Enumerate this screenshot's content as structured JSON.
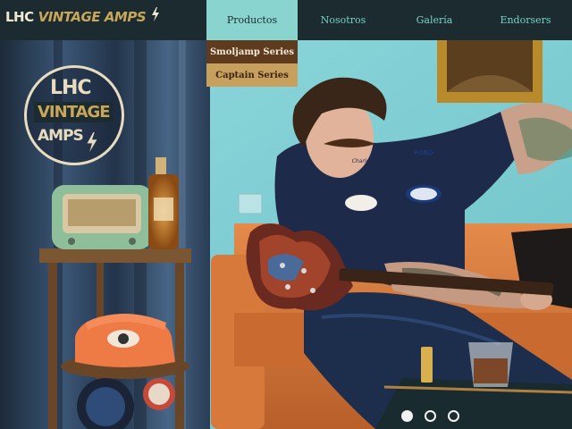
{
  "brand": {
    "part1": "LHC",
    "part2": "VINTAGE AMPS",
    "icon": "lightning-bolt-icon"
  },
  "nav": {
    "items": [
      {
        "label": "Productos",
        "active": true
      },
      {
        "label": "Nosotros",
        "active": false
      },
      {
        "label": "Galería",
        "active": false
      },
      {
        "label": "Endorsers",
        "active": false
      }
    ],
    "dropdown": [
      {
        "label": "Smoljamp Series"
      },
      {
        "label": "Captain Series"
      }
    ]
  },
  "hero": {
    "logo": {
      "line1": "LHC",
      "line2": "VINTAGE",
      "line3": "AMPS"
    },
    "patches": {
      "name": "Charles",
      "badge": "FORD"
    },
    "slider": {
      "count": 3,
      "active_index": 0
    }
  },
  "colors": {
    "topbar": "#1b2b2f",
    "nav_text": "#77d2c6",
    "nav_active_bg": "#8ad4d0",
    "dropdown_dark": "#5e3a1e",
    "dropdown_gold": "#c7a05e",
    "brand_gold": "#c8a65a"
  }
}
